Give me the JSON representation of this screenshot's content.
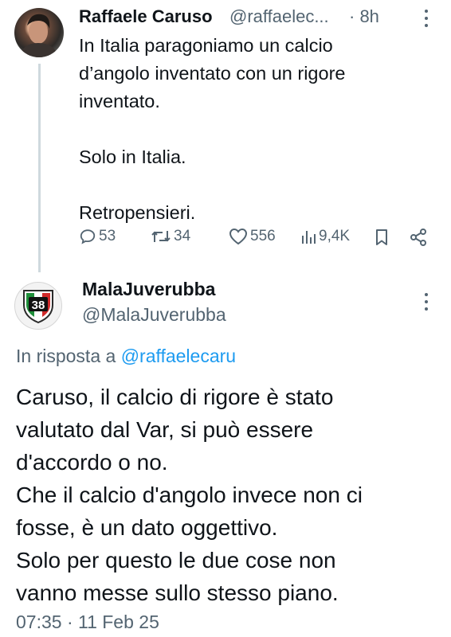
{
  "tweet1": {
    "author_name": "Raffaele Caruso",
    "author_handle": "@raffaelec...",
    "time": "· 8h",
    "text": "In Italia paragoniamo un calcio\nd’angolo inventato con un rigore\ninventato.\n\nSolo in Italia.\n\nRetropensieri.",
    "stats": {
      "replies": "53",
      "reposts": "34",
      "likes": "556",
      "views": "9,4K"
    },
    "icons": [
      "reply-icon",
      "repost-icon",
      "like-icon",
      "views-icon",
      "bookmark-icon",
      "share-icon"
    ]
  },
  "tweet2": {
    "author_name": "MalaJuverubba",
    "author_handle": "@MalaJuverubba",
    "avatar_badge": "38",
    "reply_prefix": "In risposta a",
    "reply_handle": "@raffaelecaru",
    "text": "Caruso, il calcio di rigore è stato\nvalutato dal Var, si può essere\nd'accordo o no.\nChe il calcio d'angolo invece non ci\nfosse, è un dato oggettivo.\nSolo per questo le due cose non\nvanno messe sullo stesso piano.",
    "timestamp": "07:35 · 11 Feb 25"
  },
  "colors": {
    "text": "#0f1419",
    "secondary": "#536471",
    "link": "#1d9bf0",
    "thread_line": "#cfd9de"
  }
}
